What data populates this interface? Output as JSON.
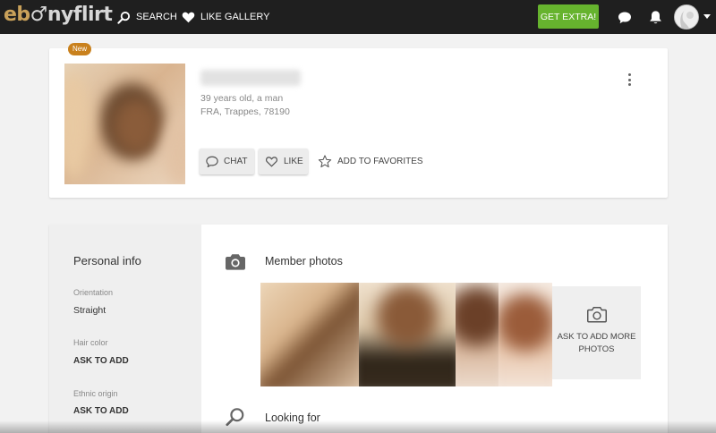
{
  "header": {
    "logo_part1": "eb",
    "logo_part2": "♂nyflirt",
    "nav": [
      {
        "label": "SEARCH",
        "icon": "search-icon"
      },
      {
        "label": "LIKE GALLERY",
        "icon": "heart-icon"
      }
    ],
    "cta_label": "GET EXTRA!",
    "cta_color": "#66b32e",
    "icons": [
      "chat-bubble-icon",
      "bell-icon",
      "avatar",
      "caret-down-icon"
    ]
  },
  "profile": {
    "badge": "New",
    "age_line": "39 years old, a man",
    "location_line": "FRA, Trappes, 78190",
    "actions": {
      "chat": "CHAT",
      "like": "LIKE",
      "favorite": "ADD TO FAVORITES"
    }
  },
  "personal_info": {
    "title": "Personal info",
    "fields": [
      {
        "label": "Orientation",
        "value": "Straight"
      },
      {
        "label": "Hair color",
        "value": "ASK TO ADD"
      },
      {
        "label": "Ethnic origin",
        "value": "ASK TO ADD"
      }
    ]
  },
  "sections": {
    "photos_title": "Member photos",
    "ask_photos": "ASK TO ADD MORE PHOTOS",
    "looking_for_title": "Looking for"
  },
  "colors": {
    "topbar": "#1f1f1f",
    "badge": "#c9811d",
    "logo_accent": "#c9a15a"
  }
}
